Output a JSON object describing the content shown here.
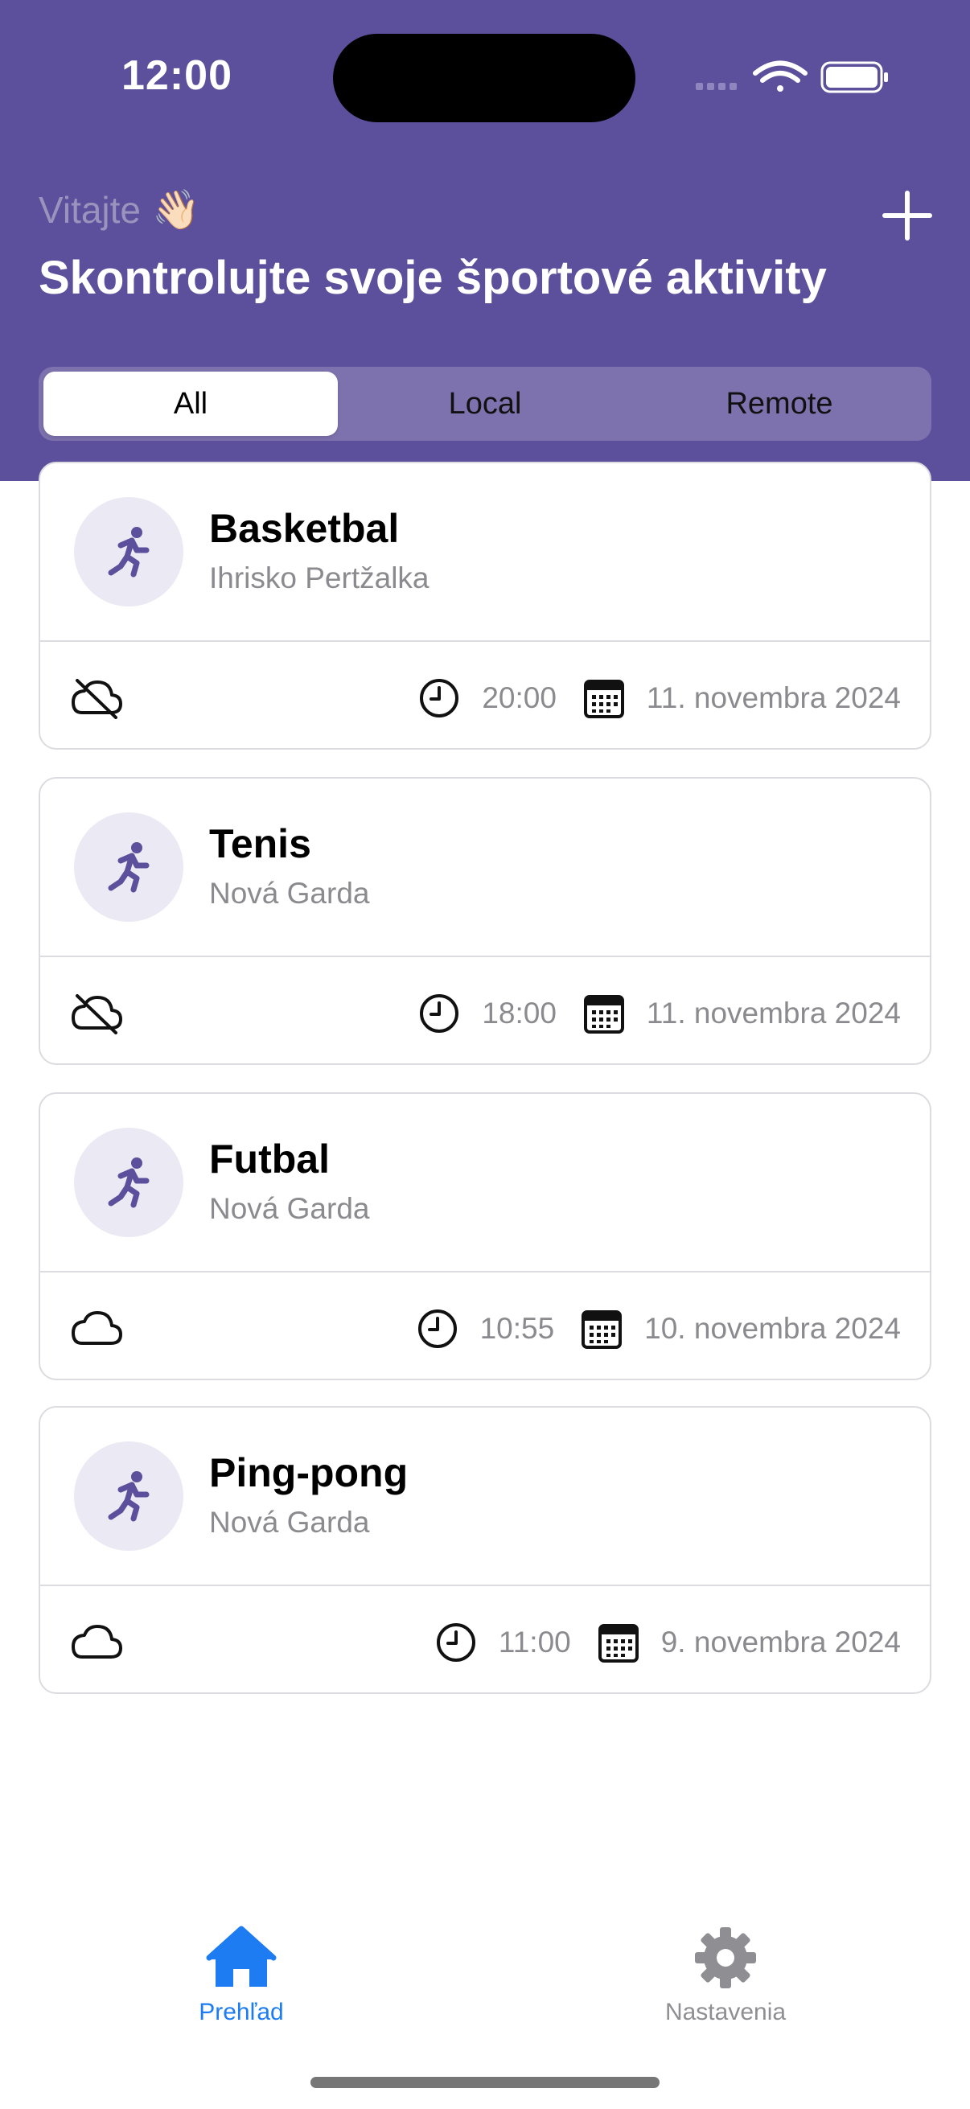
{
  "status_bar": {
    "time": "12:00",
    "icons": [
      "signal-dots-icon",
      "wifi-icon",
      "battery-icon"
    ]
  },
  "header": {
    "greeting": "Vitajte",
    "greeting_emoji": "👋🏻",
    "title": "Skontrolujte svoje športové aktivity",
    "add_icon": "plus-icon",
    "colors": {
      "background": "#5c4f9b",
      "segment_bg": "#7d72ad"
    }
  },
  "segments": [
    {
      "label": "All",
      "active": true
    },
    {
      "label": "Local",
      "active": false
    },
    {
      "label": "Remote",
      "active": false
    }
  ],
  "activities": [
    {
      "title": "Basketbal",
      "place": "Ihrisko Pertžalka",
      "sync": "cloud-off-icon",
      "time": "20:00",
      "date": "11. novembra 2024"
    },
    {
      "title": "Tenis",
      "place": "Nová Garda",
      "sync": "cloud-off-icon",
      "time": "18:00",
      "date": "11. novembra 2024"
    },
    {
      "title": "Futbal",
      "place": "Nová Garda",
      "sync": "cloud-icon",
      "time": "10:55",
      "date": "10. novembra 2024"
    },
    {
      "title": "Ping-pong",
      "place": "Nová Garda",
      "sync": "cloud-icon",
      "time": "11:00",
      "date": "9. novembra 2024"
    }
  ],
  "tabbar": {
    "home_label": "Prehľad",
    "settings_label": "Nastavenia",
    "active_color": "#1e7cf2",
    "inactive_color": "#8e8e93"
  }
}
